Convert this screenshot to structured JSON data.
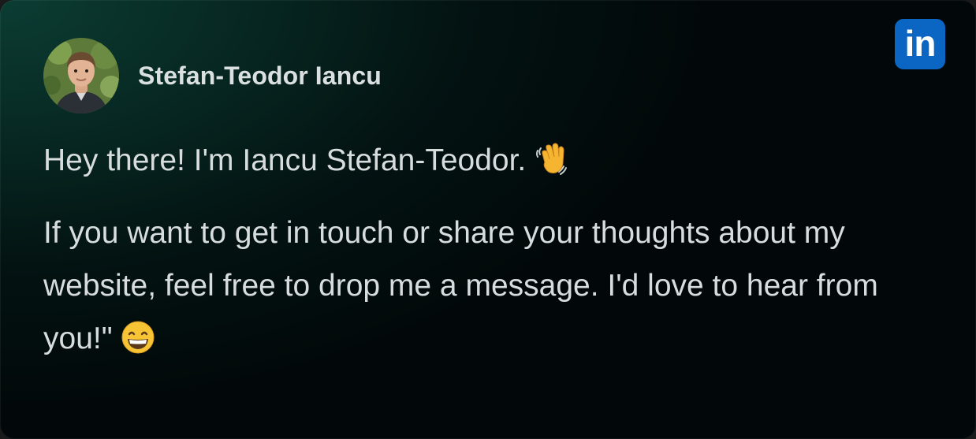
{
  "profile": {
    "name": "Stefan-Teodor Iancu",
    "avatar_icon": "profile-photo"
  },
  "social": {
    "linkedin_label": "in",
    "linkedin_color": "#0a66c2"
  },
  "message": {
    "greeting": "Hey there! I'm Iancu Stefan-Teodor.",
    "greeting_emoji": "waving-hand-icon",
    "body": "If you want to get in touch or share your thoughts about my website, feel free to drop me a message. I'd love to hear from you!\"",
    "body_emoji": "grinning-face-icon"
  },
  "colors": {
    "background_accent": "#0b3d33",
    "background_dark": "#020809",
    "text": "#d7dcdc"
  }
}
